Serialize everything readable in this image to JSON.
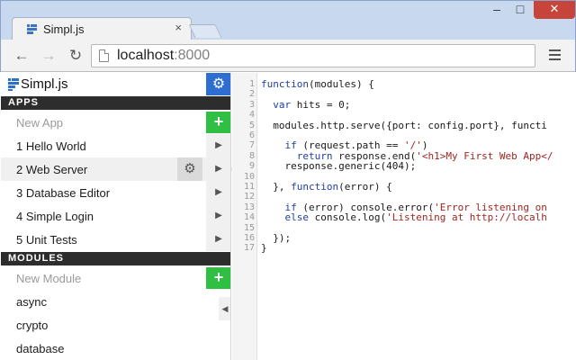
{
  "browser": {
    "tab_title": "Simpl.js",
    "tab_close": "×",
    "window_minimize": "–",
    "window_maximize": "□",
    "window_close": "✕",
    "back_glyph": "←",
    "forward_glyph": "→",
    "reload_glyph": "↻",
    "url_host": "localhost",
    "url_port": ":8000"
  },
  "sidebar": {
    "brand": "Simpl.js",
    "settings_glyph": "⚙",
    "apps_header": "APPS",
    "new_app_placeholder": "New App",
    "add_glyph": "+",
    "play_glyph": "▶",
    "collapse_glyph": "◀",
    "apps": [
      {
        "label": "1 Hello World"
      },
      {
        "label": "2 Web Server",
        "selected": true
      },
      {
        "label": "3 Database Editor"
      },
      {
        "label": "4 Simple Login"
      },
      {
        "label": "5 Unit Tests"
      }
    ],
    "modules_header": "MODULES",
    "new_module_placeholder": "New Module",
    "modules": [
      {
        "label": "async"
      },
      {
        "label": "crypto"
      },
      {
        "label": "database"
      }
    ]
  },
  "editor": {
    "colors": {
      "keyword": "#1f3ea8",
      "string": "#a1261f",
      "plain": "#1a1a1a"
    },
    "lines": [
      {
        "n": "1",
        "code": "function(modules) {"
      },
      {
        "n": "2",
        "code": ""
      },
      {
        "n": "3",
        "code": "  var hits = 0;"
      },
      {
        "n": "4",
        "code": ""
      },
      {
        "n": "5",
        "code": "  modules.http.serve({port: config.port}, functi"
      },
      {
        "n": "6",
        "code": ""
      },
      {
        "n": "7",
        "code": "    if (request.path == '/')"
      },
      {
        "n": "8",
        "code": "      return response.end('<h1>My First Web App</"
      },
      {
        "n": "9",
        "code": "    response.generic(404);"
      },
      {
        "n": "10",
        "code": ""
      },
      {
        "n": "11",
        "code": "  }, function(error) {"
      },
      {
        "n": "12",
        "code": ""
      },
      {
        "n": "13",
        "code": "    if (error) console.error('Error listening on"
      },
      {
        "n": "14",
        "code": "    else console.log('Listening at http://localh"
      },
      {
        "n": "15",
        "code": ""
      },
      {
        "n": "16",
        "code": "  });"
      },
      {
        "n": "17",
        "code": "}"
      }
    ]
  }
}
